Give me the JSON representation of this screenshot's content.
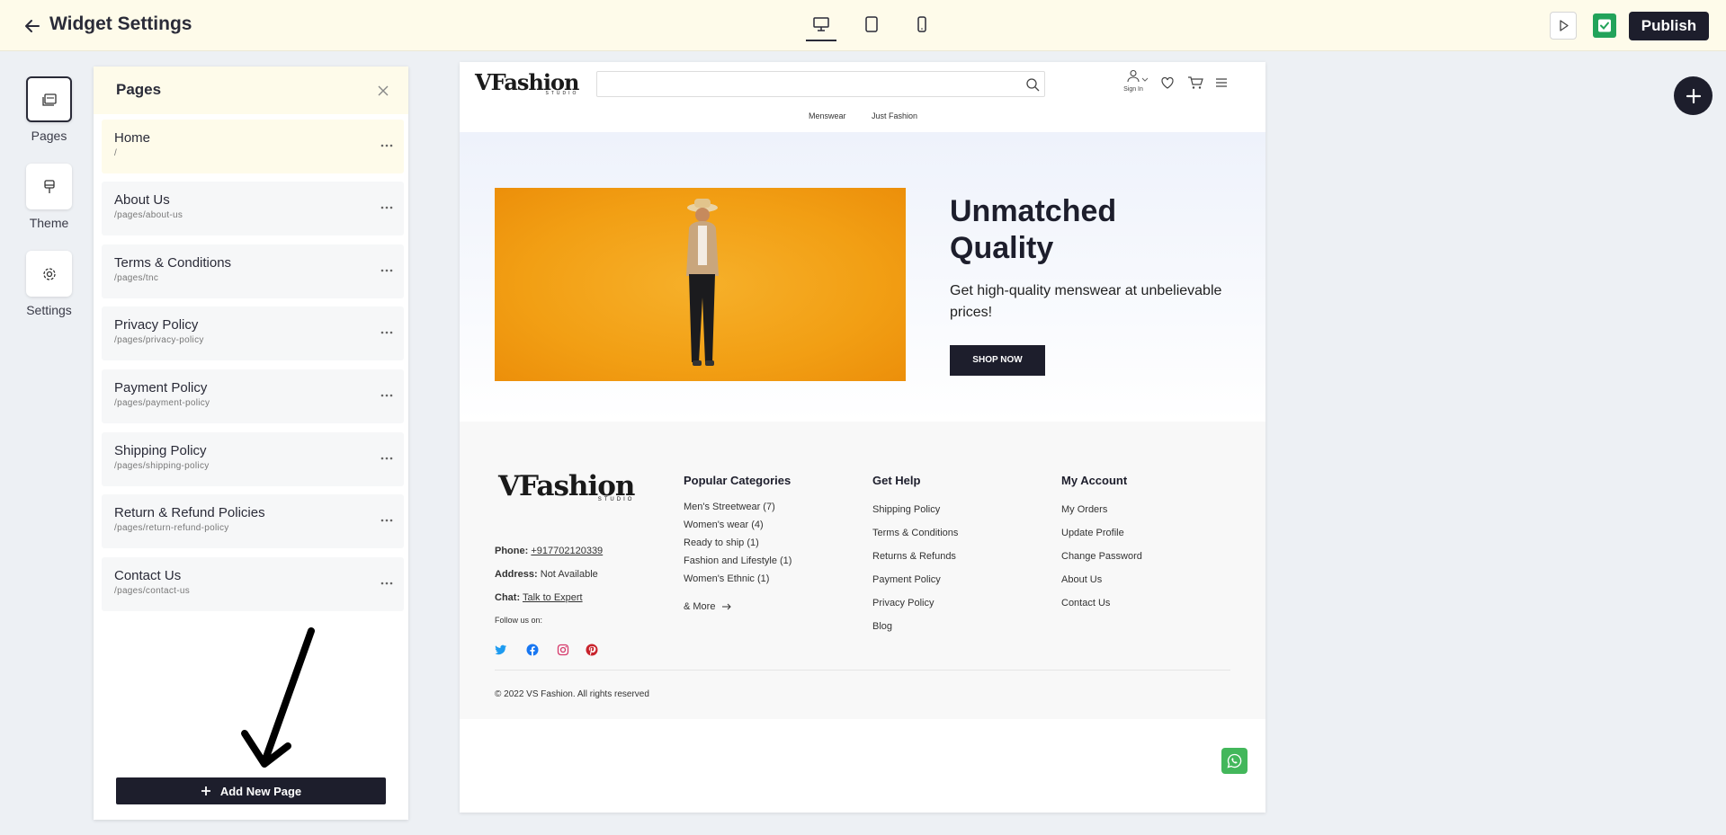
{
  "topbar": {
    "title": "Widget Settings",
    "publish_label": "Publish"
  },
  "rail": {
    "items": [
      {
        "label": "Pages"
      },
      {
        "label": "Theme"
      },
      {
        "label": "Settings"
      }
    ]
  },
  "panel": {
    "title": "Pages",
    "pages": [
      {
        "name": "Home",
        "path": "/"
      },
      {
        "name": "About Us",
        "path": "/pages/about-us"
      },
      {
        "name": "Terms & Conditions",
        "path": "/pages/tnc"
      },
      {
        "name": "Privacy Policy",
        "path": "/pages/privacy-policy"
      },
      {
        "name": "Payment Policy",
        "path": "/pages/payment-policy"
      },
      {
        "name": "Shipping Policy",
        "path": "/pages/shipping-policy"
      },
      {
        "name": "Return & Refund Policies",
        "path": "/pages/return-refund-policy"
      },
      {
        "name": "Contact Us",
        "path": "/pages/contact-us"
      }
    ],
    "add_label": "Add New Page"
  },
  "preview": {
    "logo_main": "VFashion",
    "logo_sub": "STUDIO",
    "sign_in": "Sign In",
    "nav": [
      "Menswear",
      "Just Fashion"
    ],
    "hero": {
      "title": "Unmatched Quality",
      "subtitle": "Get high-quality menswear at unbelievable prices!",
      "cta": "SHOP NOW"
    },
    "footer": {
      "phone_label": "Phone:",
      "phone": "+917702120339",
      "address_label": "Address:",
      "address": "Not Available",
      "chat_label": "Chat:",
      "chat": "Talk to Expert",
      "follow": "Follow us on:",
      "col1": {
        "title": "Popular Categories",
        "items": [
          "Men's Streetwear (7)",
          "Women's wear (4)",
          "Ready to ship (1)",
          "Fashion and Lifestyle (1)",
          "Women's Ethnic (1)"
        ],
        "more": "& More"
      },
      "col2": {
        "title": "Get Help",
        "items": [
          "Shipping Policy",
          "Terms & Conditions",
          "Returns & Refunds",
          "Payment Policy",
          "Privacy Policy",
          "Blog"
        ]
      },
      "col3": {
        "title": "My Account",
        "items": [
          "My Orders",
          "Update Profile",
          "Change Password",
          "About Us",
          "Contact Us"
        ]
      },
      "copyright": "© 2022 VS Fashion. All rights reserved"
    }
  },
  "colors": {
    "topbar_bg": "#fefbea",
    "dark": "#1d1e2c",
    "check_green": "#22a35a",
    "hero_orange": "#f29f14",
    "whatsapp": "#43b75b"
  }
}
